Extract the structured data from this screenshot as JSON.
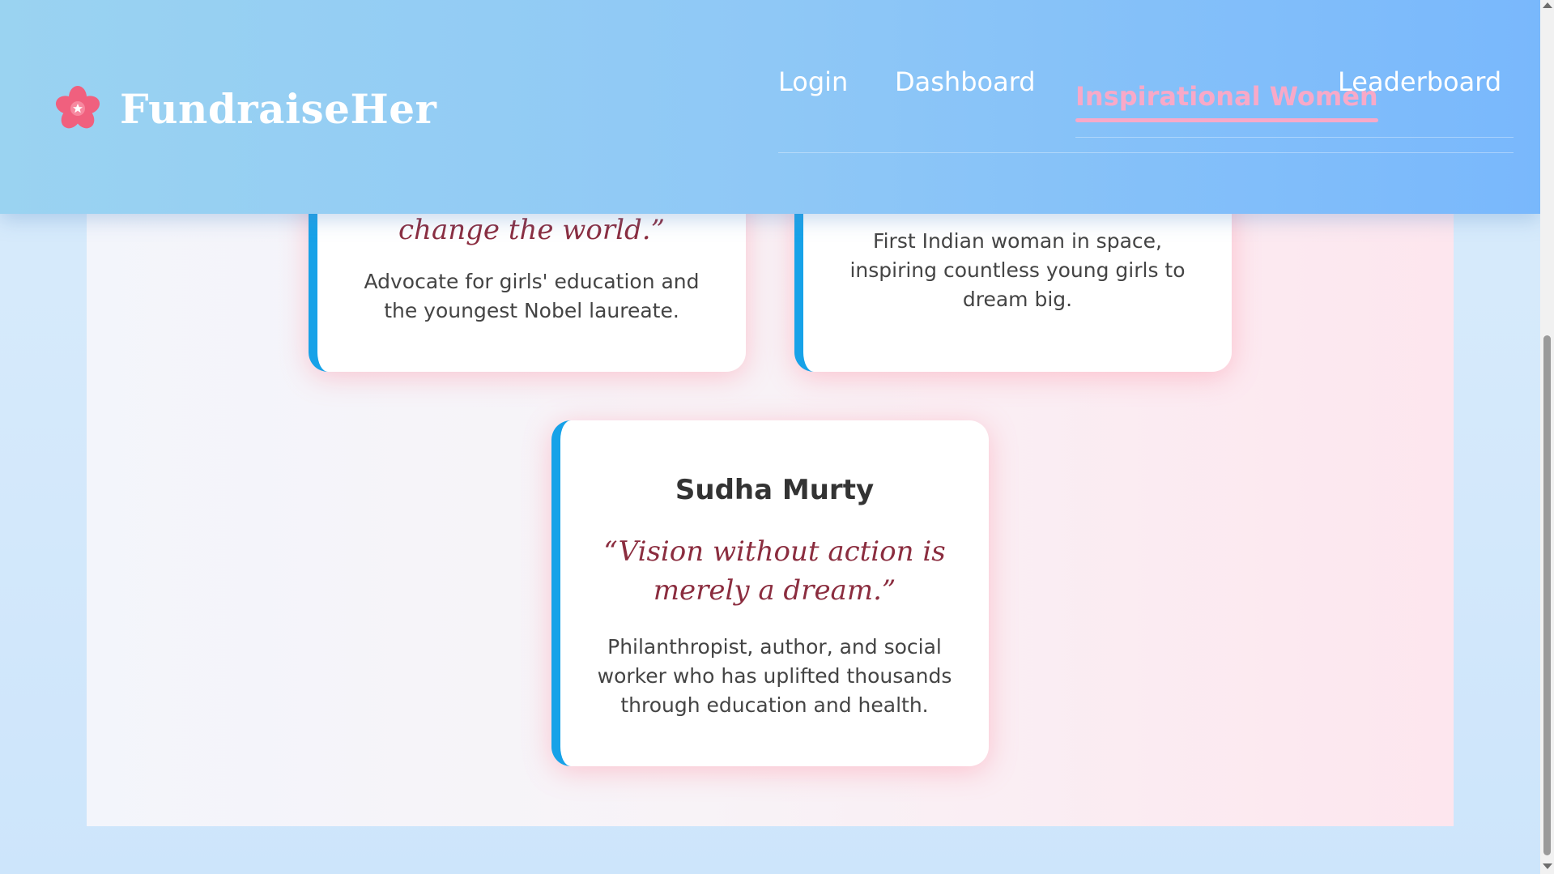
{
  "brand": {
    "name": "FundraiseHer",
    "icon": "cherry-blossom-icon"
  },
  "nav": {
    "login": "Login",
    "dashboard": "Dashboard",
    "inspirational_women": "Inspirational Women",
    "leaderboard": "Leaderboard",
    "active": "Inspirational Women"
  },
  "cards": [
    {
      "name": "",
      "quote": "change the world.”",
      "description": "Advocate for girls' education and the youngest Nobel laureate."
    },
    {
      "name": "",
      "quote": "",
      "description": "First Indian woman in space, inspiring countless young girls to dream big."
    },
    {
      "name": "Sudha Murty",
      "quote": "“Vision without action is merely a dream.”",
      "description": "Philanthropist, author, and social worker who has uplifted thousands through education and health."
    }
  ],
  "colors": {
    "header_start": "#9ad3f1",
    "header_end": "#79b8fc",
    "active_nav": "#f8a9c8",
    "card_accent": "#17a2e8",
    "quote_color": "#8b2d3f"
  }
}
